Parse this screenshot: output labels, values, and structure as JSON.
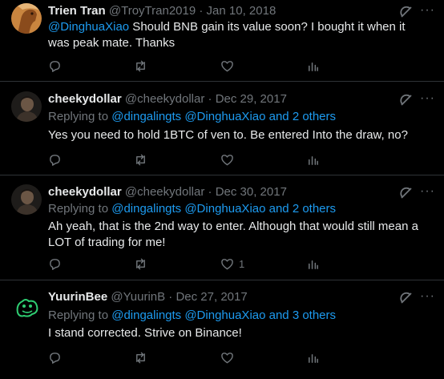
{
  "tweets": [
    {
      "name": "Trien Tran",
      "handle": "@TroyTran2019",
      "sep": "·",
      "date": "Jan 10, 2018",
      "mention": "@DinghuaXiao",
      "text": " Should BNB gain its value soon? I bought it when it was peak mate. Thanks",
      "like_count": "",
      "avatar": "orange-horse-avatar"
    },
    {
      "name": "cheekydollar",
      "handle": "@cheekydollar",
      "sep": "·",
      "date": "Dec 29, 2017",
      "replying_prefix": "Replying to ",
      "replying_users": "@dingalingts @DinghuaXiao and 2 others",
      "text": "Yes you need to hold 1BTC of ven to. Be entered Into the draw, no?",
      "like_count": "",
      "avatar": "dark-portrait-avatar"
    },
    {
      "name": "cheekydollar",
      "handle": "@cheekydollar",
      "sep": "·",
      "date": "Dec 30, 2017",
      "replying_prefix": "Replying to ",
      "replying_users": "@dingalingts @DinghuaXiao and 2 others",
      "text": "Ah yeah, that is the 2nd way to enter. Although that would still mean a LOT of trading for me!",
      "like_count": "1",
      "avatar": "dark-portrait-avatar"
    },
    {
      "name": "YuurinBee",
      "handle": "@YuurinB",
      "sep": "·",
      "date": "Dec 27, 2017",
      "replying_prefix": "Replying to ",
      "replying_users": "@dingalingts @DinghuaXiao and 3 others",
      "text": "I stand corrected. Strive on Binance!",
      "like_count": "",
      "avatar": "green-bee-avatar"
    }
  ],
  "icons": {
    "reply": "reply-icon",
    "retweet": "retweet-icon",
    "like": "like-icon",
    "views": "views-icon",
    "grok": "grok-icon",
    "more": "more-icon"
  },
  "colors": {
    "background": "#000000",
    "text": "#e7e9ea",
    "muted": "#71767b",
    "link": "#1d9bf0",
    "divider": "#2f3336"
  }
}
